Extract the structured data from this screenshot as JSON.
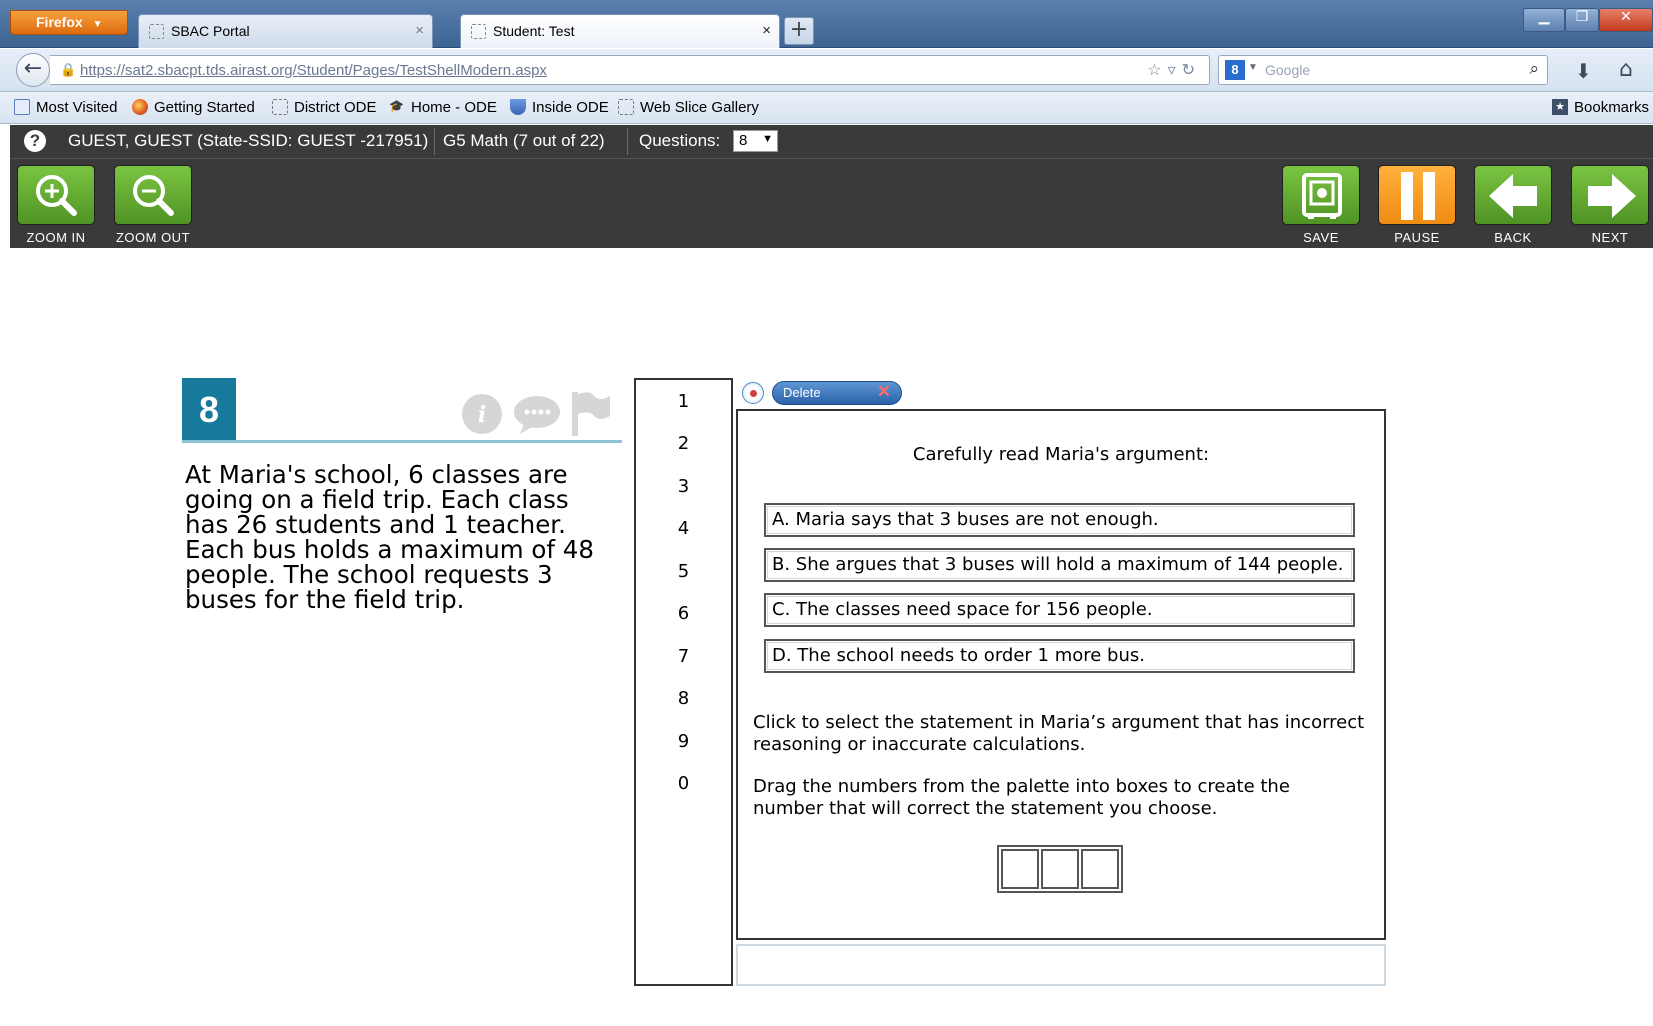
{
  "browser": {
    "menu_label": "Firefox",
    "tabs": [
      {
        "label": "SBAC Portal"
      },
      {
        "label": "Student: Test"
      }
    ],
    "new_tab": "+",
    "address": "https://sat2.sbacpt.tds.airast.org/Student/Pages/TestShellModern.aspx",
    "search_placeholder": "Google",
    "bookmarks": [
      "Most Visited",
      "Getting Started",
      "District ODE",
      "Home - ODE",
      "Inside ODE",
      "Web Slice Gallery"
    ],
    "bookmarks_menu": "Bookmarks"
  },
  "test": {
    "student_info": "GUEST, GUEST (State-SSID: GUEST -217951)",
    "test_info": "G5 Math (7 out of 22)",
    "questions_label": "Questions:",
    "questions_selected": "8",
    "tools": {
      "zoom_in": "ZOOM IN",
      "zoom_out": "ZOOM OUT",
      "save": "SAVE",
      "pause": "PAUSE",
      "back": "BACK",
      "next": "NEXT"
    }
  },
  "question": {
    "number": "8",
    "stem_lines": [
      "At Maria's school, 6 classes are",
      "going on a field trip. Each class",
      "has 26 students and 1 teacher.",
      "Each bus holds a maximum of 48",
      "people. The school requests 3",
      "buses for the field trip."
    ]
  },
  "palette": {
    "digits": [
      "1",
      "2",
      "3",
      "4",
      "5",
      "6",
      "7",
      "8",
      "9",
      "0"
    ]
  },
  "response": {
    "delete_label": "Delete",
    "prompt_title": "Carefully read Maria's argument:",
    "statements": [
      "A. Maria says that 3 buses are not enough.",
      "B. She argues that 3 buses will hold a maximum of 144 people.",
      "C. The classes need space for 156 people.",
      "D. The school needs to order 1 more bus."
    ],
    "instruction_1": [
      "Click to select the statement in Maria’s argument that has incorrect",
      "reasoning or inaccurate calculations."
    ],
    "instruction_2": [
      "Drag the numbers from the  palette into boxes to create the",
      "number that will correct the statement you choose."
    ]
  }
}
